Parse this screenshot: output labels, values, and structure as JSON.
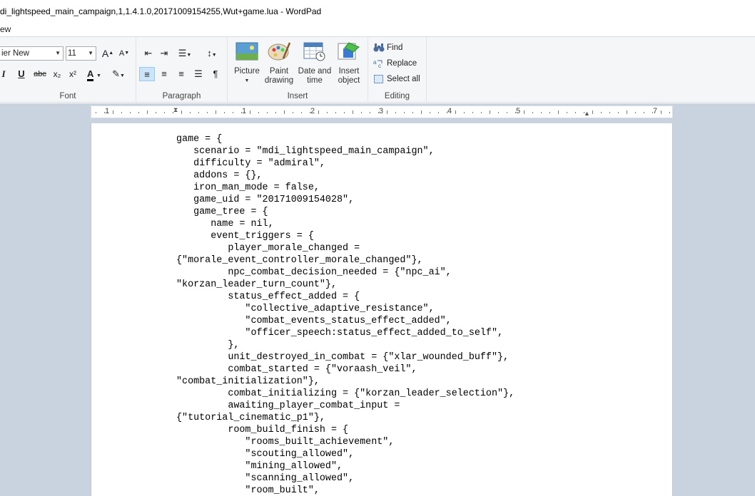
{
  "window": {
    "title": "di_lightspeed_main_campaign,1,1.4.1.0,20171009154255,Wut+game.lua - WordPad"
  },
  "menu": {
    "view_tab": "ew"
  },
  "ribbon": {
    "font": {
      "label": "Font",
      "family": "ier New",
      "size": "11",
      "grow_glyph": "A",
      "shrink_glyph": "A",
      "italic": "I",
      "underline": "U",
      "strike": "abc",
      "subscript": "x₂",
      "superscript": "x²",
      "color_glyph": "A"
    },
    "paragraph": {
      "label": "Paragraph"
    },
    "insert": {
      "label": "Insert",
      "picture": "Picture",
      "paint_line1": "Paint",
      "paint_line2": "drawing",
      "datetime_line1": "Date and",
      "datetime_line2": "time",
      "object_line1": "Insert",
      "object_line2": "object"
    },
    "editing": {
      "label": "Editing",
      "find": "Find",
      "replace": "Replace",
      "select_all": "Select all"
    }
  },
  "ruler": {
    "numbers": [
      "1",
      "1",
      "2",
      "3",
      "4",
      "5",
      "7"
    ]
  },
  "document": {
    "lines": [
      "game = {",
      "   scenario = \"mdi_lightspeed_main_campaign\",",
      "   difficulty = \"admiral\",",
      "   addons = {},",
      "   iron_man_mode = false,",
      "   game_uid = \"20171009154028\",",
      "   game_tree = {",
      "      name = nil,",
      "      event_triggers = {",
      "         player_morale_changed =",
      "{\"morale_event_controller_morale_changed\"},",
      "         npc_combat_decision_needed = {\"npc_ai\",",
      "\"korzan_leader_turn_count\"},",
      "         status_effect_added = {",
      "            \"collective_adaptive_resistance\",",
      "            \"combat_events_status_effect_added\",",
      "            \"officer_speech:status_effect_added_to_self\",",
      "         },",
      "         unit_destroyed_in_combat = {\"xlar_wounded_buff\"},",
      "         combat_started = {\"voraash_veil\",",
      "\"combat_initialization\"},",
      "         combat_initializing = {\"korzan_leader_selection\"},",
      "         awaiting_player_combat_input =",
      "{\"tutorial_cinematic_p1\"},",
      "         room_build_finish = {",
      "            \"rooms_built_achievement\",",
      "            \"scouting_allowed\",",
      "            \"mining_allowed\",",
      "            \"scanning_allowed\",",
      "            \"room_built\","
    ]
  }
}
